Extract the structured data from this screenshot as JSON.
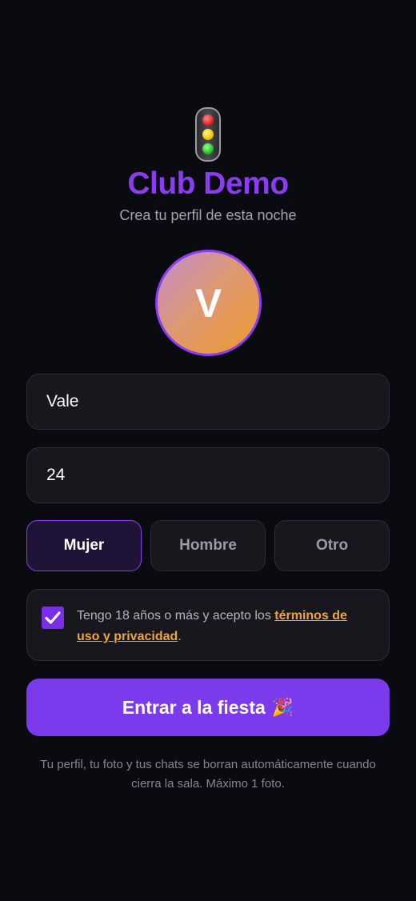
{
  "header": {
    "logo_icon": "traffic-light-icon",
    "title": "Club Demo",
    "subtitle": "Crea tu perfil de esta noche"
  },
  "avatar": {
    "initial": "V"
  },
  "form": {
    "name_value": "Vale",
    "age_value": "24",
    "genders": [
      {
        "label": "Mujer",
        "selected": true
      },
      {
        "label": "Hombre",
        "selected": false
      },
      {
        "label": "Otro",
        "selected": false
      }
    ],
    "consent": {
      "checked": true,
      "text_before": "Tengo 18 años o más y acepto los ",
      "link_text": "términos de uso y privacidad",
      "text_after": "."
    }
  },
  "cta": {
    "label": "Entrar a la fiesta",
    "emoji": "🎉"
  },
  "footnote": "Tu perfil, tu foto y tus chats se borran automáticamente cuando cierra la sala. Máximo 1 foto.",
  "colors": {
    "accent": "#7c3aed",
    "title": "#8b3cf0",
    "link": "#f0a43a",
    "background": "#0a0b10"
  }
}
